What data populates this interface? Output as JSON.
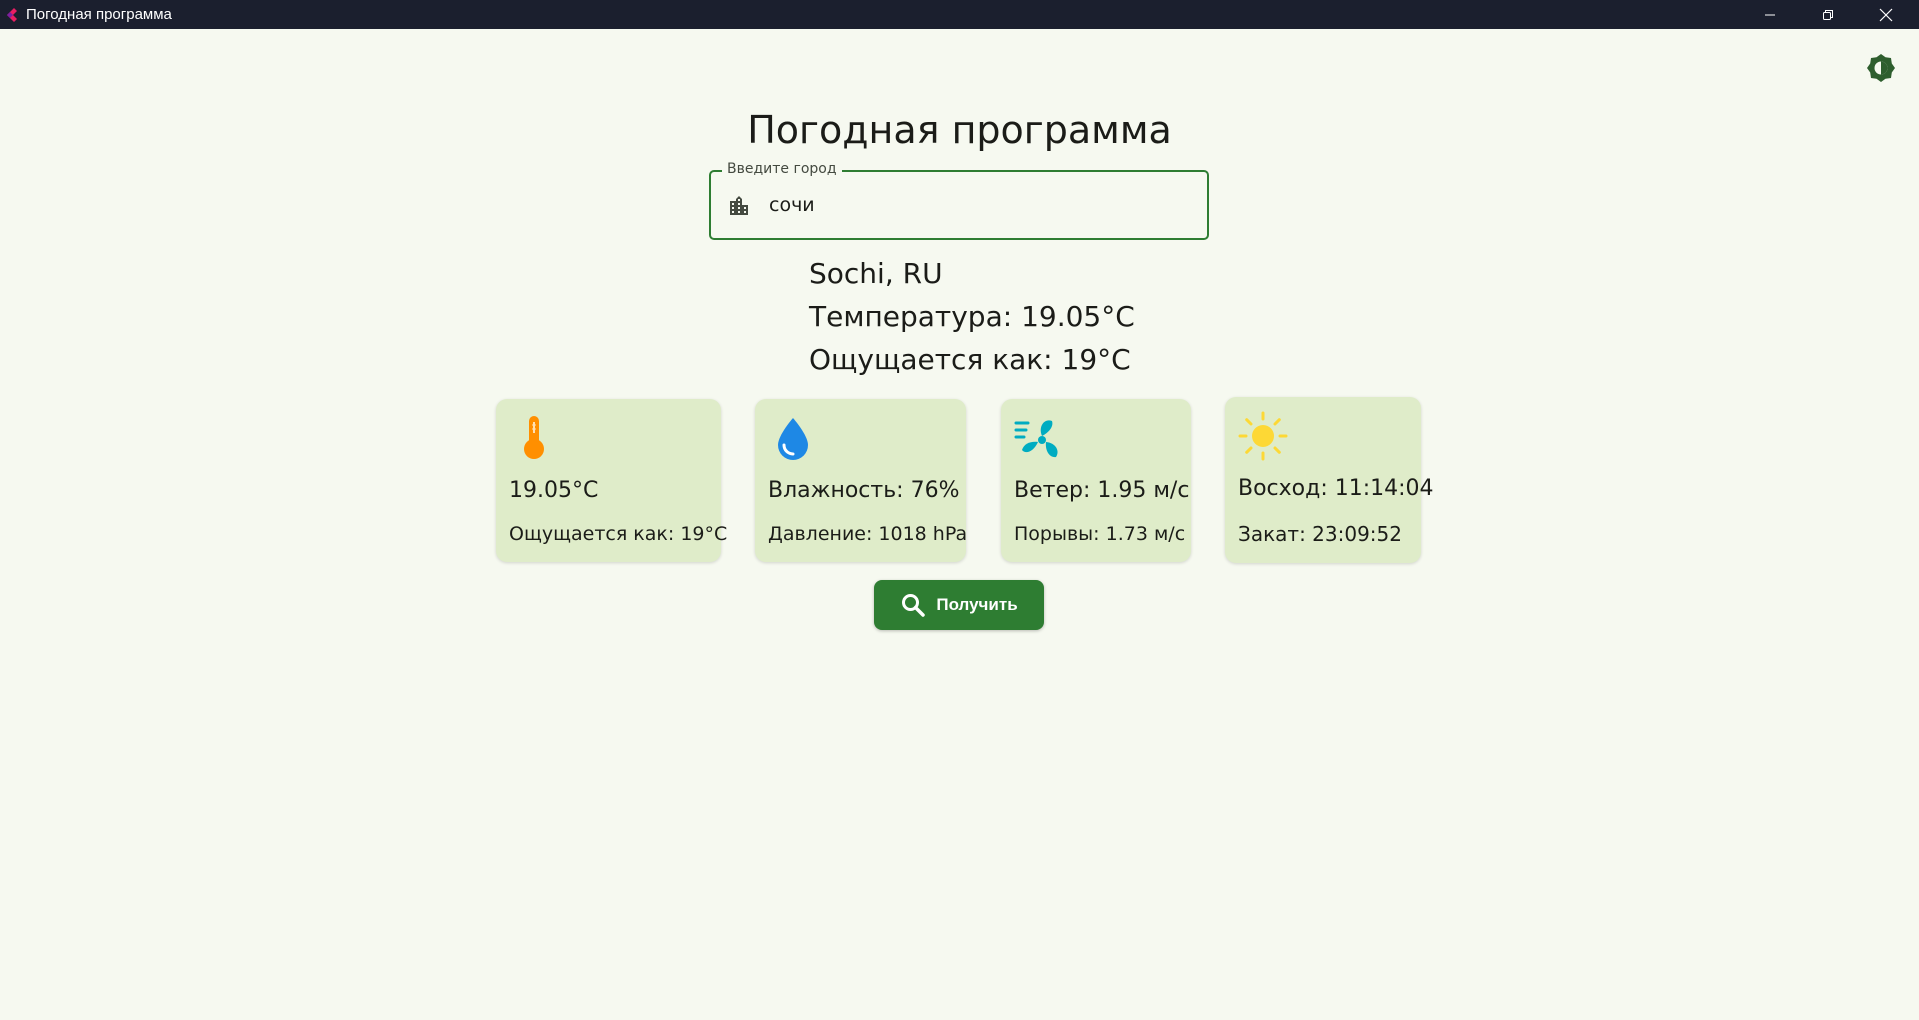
{
  "window": {
    "title": "Погодная программа",
    "controls": [
      "minimize-icon",
      "restore-icon",
      "close-icon"
    ]
  },
  "theme_toggle": {
    "icon": "brightness-icon",
    "color": "#2e5e2e"
  },
  "heading": "Погодная программа",
  "city_input": {
    "label": "Введите город",
    "value": "сочи",
    "icon": "city-icon"
  },
  "result": {
    "location": "Sochi, RU",
    "temperature": "Температура: 19.05°C",
    "feels_like": "Ощущается как: 19°C"
  },
  "cards": [
    {
      "icon": "thermometer-icon",
      "line1": "19.05°C",
      "line2": "Ощущается как: 19°C"
    },
    {
      "icon": "water-drop-icon",
      "line1": "Влажность: 76%",
      "line2": "Давление: 1018 hPa"
    },
    {
      "icon": "wind-fan-icon",
      "line1": "Ветер: 1.95 м/с",
      "line2": "Порывы: 1.73 м/с"
    },
    {
      "icon": "sun-icon",
      "line1": "Восход: 11:14:04",
      "line2": "Закат: 23:09:52"
    }
  ],
  "fetch_button": {
    "label": "Получить",
    "icon": "search-icon"
  },
  "colors": {
    "background": "#f6f9f0",
    "accent": "#2e7d32",
    "card": "#dfecc9",
    "titlebar": "#1b1f2e",
    "thermometer": "#ff8f00",
    "water": "#1e88e5",
    "wind": "#00acc1",
    "sun": "#fdd835"
  }
}
